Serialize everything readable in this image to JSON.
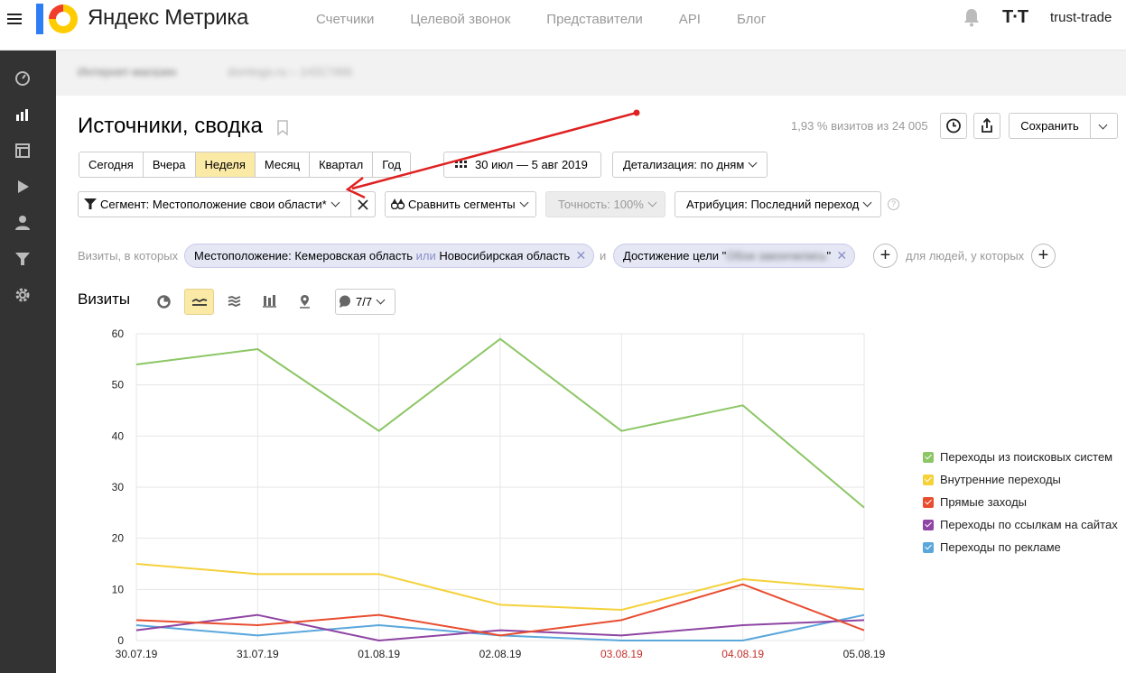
{
  "app": {
    "logo_text": "Яндекс Метрика",
    "nav": [
      "Счетчики",
      "Целевой звонок",
      "Представители",
      "API",
      "Блог"
    ],
    "user_logo": "T·T",
    "user_name": "trust-trade"
  },
  "counter": {
    "name": "Интернет-магазин",
    "site": "domtogo.ru – 14317466"
  },
  "header": {
    "title": "Источники, сводка",
    "share_text": "1,93 % визитов из 24 005",
    "save_label": "Сохранить"
  },
  "period": {
    "tabs": [
      "Сегодня",
      "Вчера",
      "Неделя",
      "Месяц",
      "Квартал",
      "Год"
    ],
    "active": "Неделя",
    "date_range": "30 июл — 5 авг 2019",
    "detail": "Детализация: по дням"
  },
  "segment": {
    "label": "Сегмент: Местоположение свои области*",
    "compare": "Сравнить сегменты",
    "accuracy": "Точность: 100%",
    "attribution": "Атрибуция: Последний переход"
  },
  "filters": {
    "prefix": "Визиты, в которых",
    "chip1_a": "Местоположение: Кемеровская область",
    "chip1_or": "или",
    "chip1_b": "Новосибирская область",
    "and": "и",
    "chip2_prefix": "Достижение цели \"",
    "chip2_blur": "Обои закончились",
    "chip2_suffix": "\"",
    "people": "для людей, у которых"
  },
  "chart_header": {
    "title": "Визиты",
    "series_count": "7/7"
  },
  "colors": {
    "search": "#8cc665",
    "internal": "#f5d13a",
    "direct": "#e84d2f",
    "links": "#8e45a3",
    "ads": "#5aa7dc",
    "weekend": "#c4302b"
  },
  "chart_data": {
    "type": "line",
    "categories": [
      "30.07.19",
      "31.07.19",
      "01.08.19",
      "02.08.19",
      "03.08.19",
      "04.08.19",
      "05.08.19"
    ],
    "weekend_categories": [
      "03.08.19",
      "04.08.19"
    ],
    "ylim": [
      0,
      60
    ],
    "yticks": [
      0,
      10,
      20,
      30,
      40,
      50,
      60
    ],
    "grid": true,
    "legend_position": "right",
    "series": [
      {
        "name": "Переходы из поисковых систем",
        "color_key": "search",
        "values": [
          54,
          57,
          41,
          59,
          41,
          46,
          26
        ]
      },
      {
        "name": "Внутренние переходы",
        "color_key": "internal",
        "values": [
          15,
          13,
          13,
          7,
          6,
          12,
          10
        ]
      },
      {
        "name": "Прямые заходы",
        "color_key": "direct",
        "values": [
          4,
          3,
          5,
          1,
          4,
          11,
          2
        ]
      },
      {
        "name": "Переходы по ссылкам на сайтах",
        "color_key": "links",
        "values": [
          2,
          5,
          0,
          2,
          1,
          3,
          4
        ]
      },
      {
        "name": "Переходы по рекламе",
        "color_key": "ads",
        "values": [
          3,
          1,
          3,
          1,
          0,
          0,
          5
        ]
      }
    ]
  }
}
